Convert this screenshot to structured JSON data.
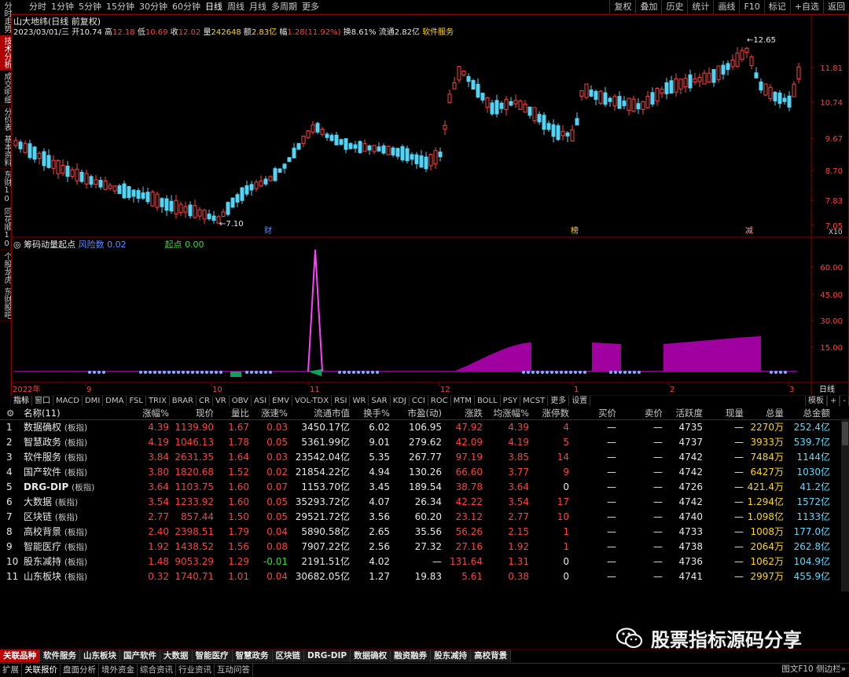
{
  "periods": [
    "分时",
    "1分钟",
    "5分钟",
    "15分钟",
    "30分钟",
    "60分钟",
    "日线",
    "周线",
    "月线",
    "多周期",
    "更多"
  ],
  "active_period": "日线",
  "tools": [
    "复权",
    "叠加",
    "历史",
    "统计",
    "画线",
    "F10",
    "标记",
    "+自选",
    "返回"
  ],
  "left_strip": [
    "分时走势",
    "技术分析",
    "成交明细",
    "分价表",
    "基本资料",
    "东财10",
    "同花顺10",
    "个股龙虎",
    "东财股吧"
  ],
  "active_left": "技术分析",
  "kline": {
    "title": "山大地纬(日线 前复权)",
    "date": "2023/03/01/三",
    "open_label": "开",
    "open": "10.74",
    "high_label": "高",
    "high": "12.18",
    "low_label": "低",
    "low": "10.69",
    "close_label": "收",
    "close": "12.02",
    "vol_label": "量",
    "vol": "242648",
    "amt_label": "额",
    "amt": "2.83亿",
    "chg_label": "幅",
    "chg": "1.28(11.92%)",
    "turn_label": "换",
    "turn": "8.61%",
    "float_label": "流通",
    "float": "2.82亿",
    "industry": "软件服务",
    "price_levels": [
      "11.81",
      "10.74",
      "9.67",
      "8.70",
      "7.83",
      "7.05"
    ],
    "hi_mark": "12.65",
    "lo_mark": "7.10",
    "events": [
      "财",
      "榜",
      "减"
    ],
    "zoom": "X10"
  },
  "indicator": {
    "name": "筹码动量起点",
    "line1_label": "风险数",
    "line1_value": "0.02",
    "line2_label": "起点",
    "line2_value": "0.00",
    "levels": [
      "60.00",
      "45.00",
      "30.00",
      "15.00"
    ],
    "x_labels": [
      "2022年",
      "9",
      "10",
      "11",
      "12",
      "1",
      "2",
      "3"
    ],
    "right_label": "日线"
  },
  "indicator_tabs": [
    "指标",
    "窗口",
    "MACD",
    "DMI",
    "DMA",
    "FSL",
    "TRIX",
    "BRAR",
    "CR",
    "VR",
    "OBV",
    "ASI",
    "EMV",
    "VOL-TDX",
    "RSI",
    "WR",
    "SAR",
    "KDJ",
    "CCI",
    "ROC",
    "MTM",
    "BOLL",
    "PSY",
    "MCST",
    "更多",
    "设置"
  ],
  "indicator_tabs_right": [
    "模板",
    "+",
    "-"
  ],
  "table": {
    "header": [
      "名称(11)",
      "涨幅%",
      "现价",
      "量比",
      "涨速%",
      "流通市值",
      "换手%",
      "市盈(动)",
      "涨跌",
      "均涨幅%",
      "涨停数",
      "买价",
      "卖价",
      "活跃度",
      "现量",
      "总量",
      "总金额"
    ],
    "rows": [
      {
        "idx": "1",
        "name": "数据确权",
        "tag": "(板指)",
        "chg": "4.39",
        "price": "1139.90",
        "lb": "1.67",
        "spd": "0.03",
        "mv": "3450.17亿",
        "turn": "6.02",
        "pe": "106.95",
        "zd": "47.92",
        "avg": "4.39",
        "zt": "4",
        "buy": "—",
        "sell": "—",
        "act": "4735",
        "xl": "—",
        "zl": "2270万",
        "zje": "252.4亿"
      },
      {
        "idx": "2",
        "name": "智慧政务",
        "tag": "(板指)",
        "chg": "4.19",
        "price": "1046.13",
        "lb": "1.78",
        "spd": "0.05",
        "mv": "5361.99亿",
        "turn": "9.01",
        "pe": "279.62",
        "zd": "42.09",
        "avg": "4.19",
        "zt": "5",
        "buy": "—",
        "sell": "—",
        "act": "4737",
        "xl": "—",
        "zl": "3933万",
        "zje": "539.7亿"
      },
      {
        "idx": "3",
        "name": "软件服务",
        "tag": "(板指)",
        "chg": "3.84",
        "price": "2631.35",
        "lb": "1.64",
        "spd": "0.03",
        "mv": "23542.04亿",
        "turn": "5.35",
        "pe": "267.77",
        "zd": "97.19",
        "avg": "3.85",
        "zt": "14",
        "buy": "—",
        "sell": "—",
        "act": "4742",
        "xl": "—",
        "zl": "7484万",
        "zje": "1144亿"
      },
      {
        "idx": "4",
        "name": "国产软件",
        "tag": "(板指)",
        "chg": "3.80",
        "price": "1820.68",
        "lb": "1.52",
        "spd": "0.02",
        "mv": "21854.22亿",
        "turn": "4.94",
        "pe": "130.26",
        "zd": "66.60",
        "avg": "3.77",
        "zt": "9",
        "buy": "—",
        "sell": "—",
        "act": "4742",
        "xl": "—",
        "zl": "6427万",
        "zje": "1030亿"
      },
      {
        "idx": "5",
        "name": "DRG-DIP",
        "tag": "(板指)",
        "chg": "3.64",
        "price": "1103.75",
        "lb": "1.60",
        "spd": "0.07",
        "mv": "1153.70亿",
        "turn": "3.45",
        "pe": "189.54",
        "zd": "38.78",
        "avg": "3.64",
        "zt": "0",
        "buy": "—",
        "sell": "—",
        "act": "4726",
        "xl": "—",
        "zl": "421.4万",
        "zje": "41.2亿"
      },
      {
        "idx": "6",
        "name": "大数据",
        "tag": "(板指)",
        "chg": "3.54",
        "price": "1233.92",
        "lb": "1.60",
        "spd": "0.05",
        "mv": "35293.72亿",
        "turn": "4.07",
        "pe": "26.34",
        "zd": "42.22",
        "avg": "3.54",
        "zt": "17",
        "buy": "—",
        "sell": "—",
        "act": "4742",
        "xl": "—",
        "zl": "1.294亿",
        "zje": "1572亿"
      },
      {
        "idx": "7",
        "name": "区块链",
        "tag": "(板指)",
        "chg": "2.77",
        "price": "857.44",
        "lb": "1.50",
        "spd": "0.05",
        "mv": "29521.72亿",
        "turn": "3.56",
        "pe": "60.20",
        "zd": "23.12",
        "avg": "2.77",
        "zt": "10",
        "buy": "—",
        "sell": "—",
        "act": "4740",
        "xl": "—",
        "zl": "1.098亿",
        "zje": "1133亿"
      },
      {
        "idx": "8",
        "name": "高校背景",
        "tag": "(板指)",
        "chg": "2.40",
        "price": "2398.51",
        "lb": "1.79",
        "spd": "0.04",
        "mv": "5890.58亿",
        "turn": "2.65",
        "pe": "35.56",
        "zd": "56.26",
        "avg": "2.15",
        "zt": "1",
        "buy": "—",
        "sell": "—",
        "act": "4733",
        "xl": "—",
        "zl": "1008万",
        "zje": "177.0亿"
      },
      {
        "idx": "9",
        "name": "智能医疗",
        "tag": "(板指)",
        "chg": "1.92",
        "price": "1438.52",
        "lb": "1.56",
        "spd": "0.08",
        "mv": "7907.22亿",
        "turn": "2.56",
        "pe": "27.32",
        "zd": "27.16",
        "avg": "1.92",
        "zt": "1",
        "buy": "—",
        "sell": "—",
        "act": "4738",
        "xl": "—",
        "zl": "2064万",
        "zje": "262.8亿"
      },
      {
        "idx": "10",
        "name": "股东减持",
        "tag": "(板指)",
        "chg": "1.48",
        "price": "9053.29",
        "lb": "1.29",
        "spd": "-0.01",
        "mv": "2191.51亿",
        "turn": "4.02",
        "pe": "—",
        "zd": "131.64",
        "avg": "1.31",
        "zt": "0",
        "buy": "—",
        "sell": "—",
        "act": "4736",
        "xl": "—",
        "zl": "1062万",
        "zje": "104.9亿"
      },
      {
        "idx": "11",
        "name": "山东板块",
        "tag": "(板指)",
        "chg": "0.32",
        "price": "1740.71",
        "lb": "1.01",
        "spd": "0.04",
        "mv": "30682.05亿",
        "turn": "1.27",
        "pe": "19.83",
        "zd": "5.61",
        "avg": "0.38",
        "zt": "0",
        "buy": "—",
        "sell": "—",
        "act": "4741",
        "xl": "—",
        "zl": "2997万",
        "zje": "455.9亿"
      }
    ]
  },
  "watermark": "股票指标源码分享",
  "sector_tabs": [
    "关联品种",
    "软件服务",
    "山东板块",
    "国产软件",
    "大数据",
    "智能医疗",
    "智慧政务",
    "区块链",
    "DRG-DIP",
    "数据确权",
    "融资融券",
    "股东减持",
    "高校背景"
  ],
  "active_sector": "关联品种",
  "func_tabs": [
    "扩展",
    "关联报价",
    "盘面分析",
    "境外资金",
    "综合资讯",
    "行业资讯",
    "互动问答"
  ],
  "active_func": "关联报价",
  "func_right": "图文F10 侧边栏»",
  "colors": {
    "up": "#ff4040",
    "down": "#5adcff",
    "bg": "#000000",
    "grid": "#8b0000",
    "indicator": "#a000a0"
  }
}
